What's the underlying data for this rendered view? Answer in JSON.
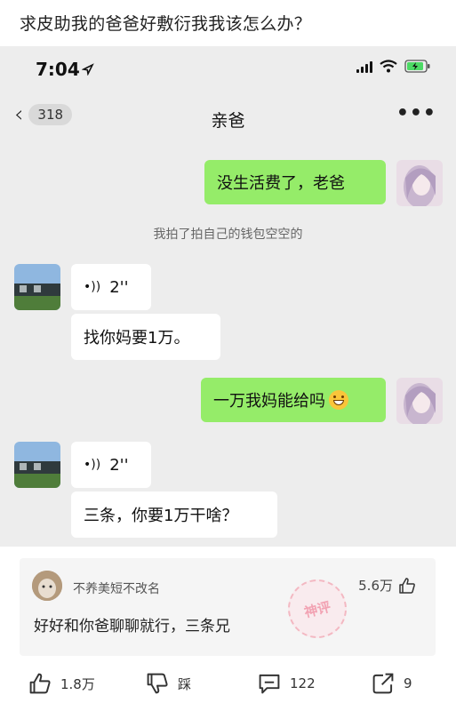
{
  "post": {
    "title": "求皮助我的爸爸好敷衍我我该怎么办？"
  },
  "statusbar": {
    "time": "7:04"
  },
  "navbar": {
    "badge": "318",
    "title": "亲爸",
    "more": "•••"
  },
  "messages": {
    "m1": "没生活费了，老爸",
    "system": "我拍了拍自己的钱包空空的",
    "voice1": "2''",
    "m2": "找你妈要1万。",
    "m3": "一万我妈能给吗",
    "voice2": "2''",
    "m4": "三条，你要1万干啥？"
  },
  "comment": {
    "username": "不养美短不改名",
    "likes": "5.6万",
    "text": "好好和你爸聊聊就行，三条兄",
    "stamp": "神评"
  },
  "actions": {
    "like": "1.8万",
    "dislike": "踩",
    "comments": "122",
    "share": "9"
  },
  "colors": {
    "my_bubble": "#95ec69",
    "chat_bg": "#ededed"
  }
}
